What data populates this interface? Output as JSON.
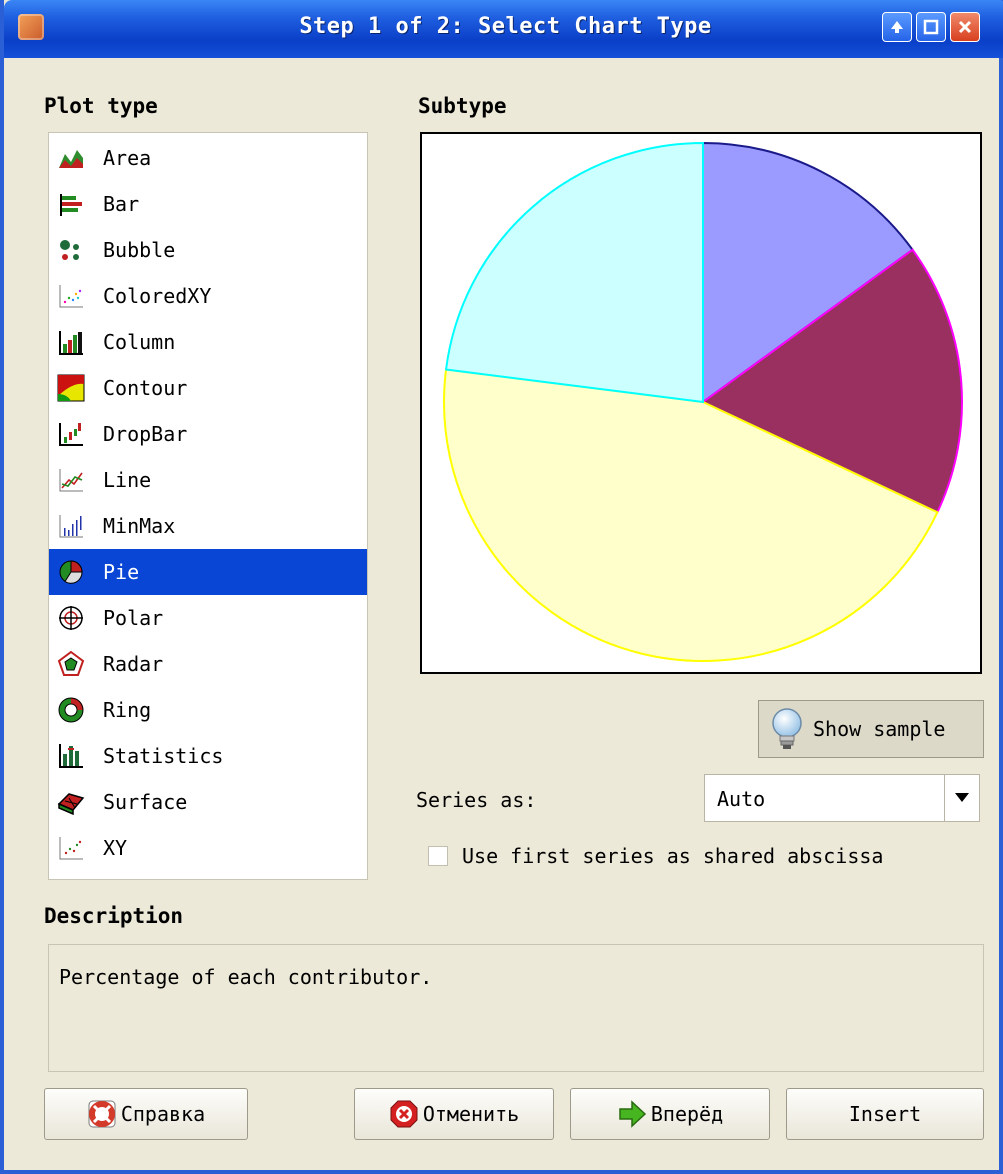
{
  "window": {
    "title": "Step 1 of 2: Select Chart Type"
  },
  "plot_type": {
    "heading": "Plot type",
    "items": [
      "Area",
      "Bar",
      "Bubble",
      "ColoredXY",
      "Column",
      "Contour",
      "DropBar",
      "Line",
      "MinMax",
      "Pie",
      "Polar",
      "Radar",
      "Ring",
      "Statistics",
      "Surface",
      "XY"
    ],
    "selected": "Pie"
  },
  "subtype": {
    "heading": "Subtype"
  },
  "preview_pie": {
    "slices": [
      {
        "fraction": 0.15,
        "fill": "#9a9aff",
        "stroke": "#1a1a8a"
      },
      {
        "fraction": 0.17,
        "fill": "#99305f",
        "stroke": "#ff00ff"
      },
      {
        "fraction": 0.45,
        "fill": "#ffffcc",
        "stroke": "#ffff00"
      },
      {
        "fraction": 0.23,
        "fill": "#ccffff",
        "stroke": "#00ffff"
      }
    ]
  },
  "show_sample": {
    "label": "Show sample"
  },
  "series_as": {
    "label": "Series as:",
    "value": "Auto"
  },
  "shared_abscissa": {
    "label": "Use first series as shared abscissa",
    "checked": false
  },
  "description": {
    "heading": "Description",
    "text": "Percentage of each contributor."
  },
  "buttons": {
    "help": "Справка",
    "cancel": "Отменить",
    "next": "Вперёд",
    "insert": "Insert"
  },
  "colors": {
    "selection": "#0a46d6",
    "titlebar": "#0a3fc8"
  }
}
